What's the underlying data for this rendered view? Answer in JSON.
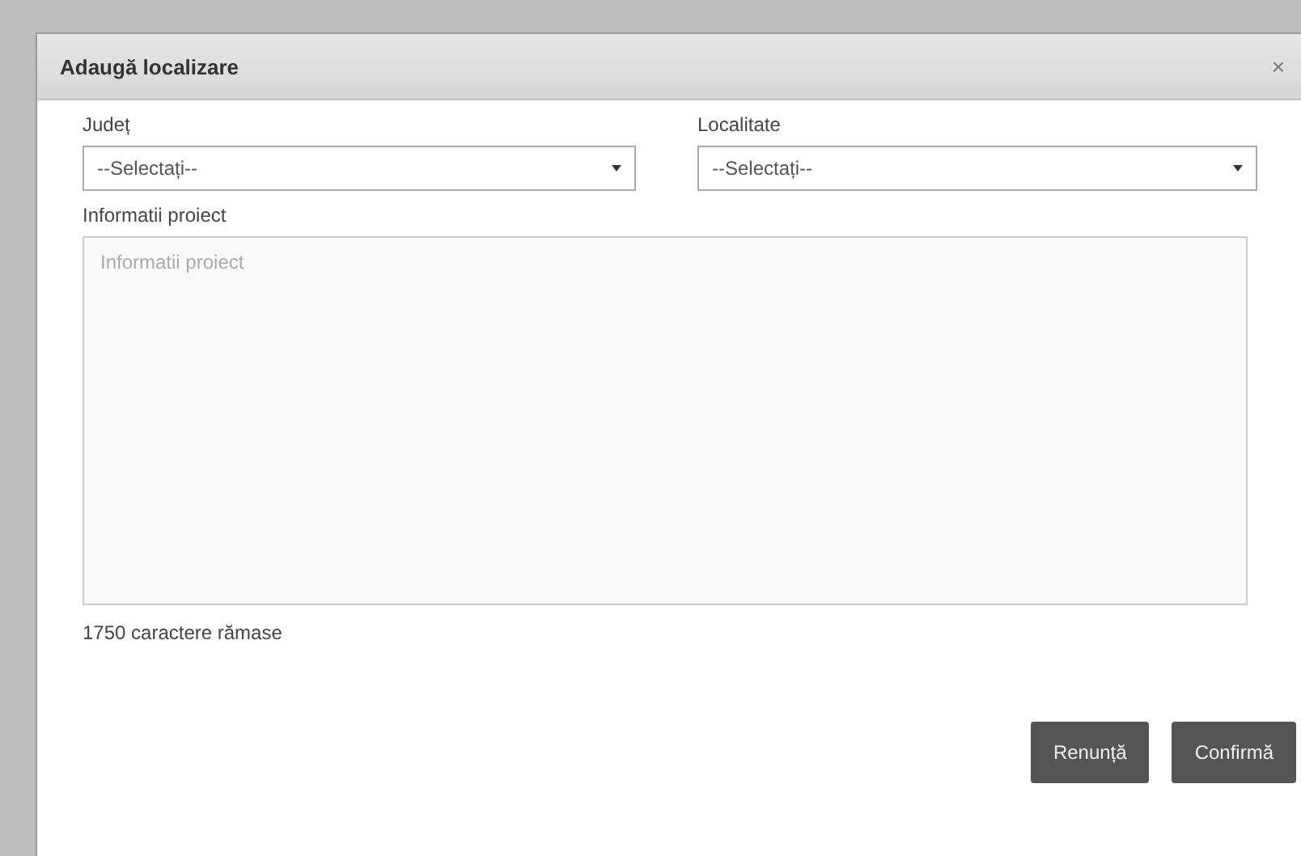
{
  "dialog": {
    "title": "Adaugă localizare",
    "close": "×"
  },
  "fields": [
    {
      "label": "Județ",
      "value": "--Selectați--"
    },
    {
      "label": "Localitate",
      "value": "--Selectați--"
    }
  ],
  "project": {
    "label": "Informatii proiect",
    "placeholder": "Informatii proiect",
    "counter": "1750 caractere rămase"
  },
  "buttons": [
    "Renunță",
    "Confirmă"
  ]
}
